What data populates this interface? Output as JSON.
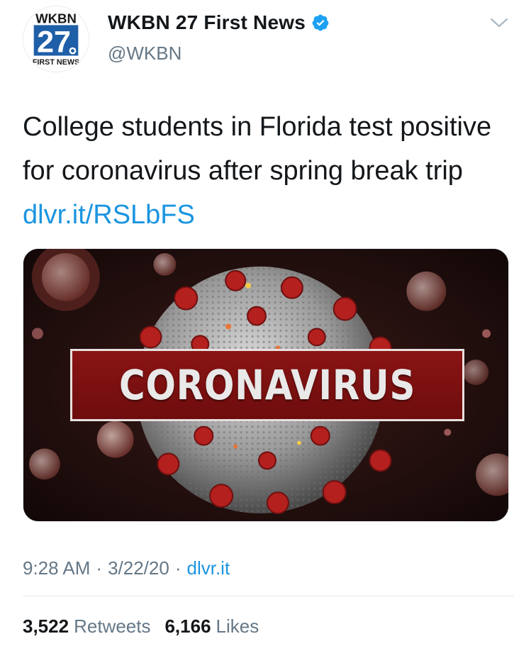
{
  "account": {
    "display_name": "WKBN 27 First News",
    "handle": "@WKBN",
    "avatar_logo": {
      "call_letters": "WKBN",
      "channel": "27",
      "tagline": "FIRST NEWS",
      "brand_color": "#1f5fa8"
    },
    "verified_icon": "verified-badge-icon"
  },
  "menu_icon": "chevron-down-icon",
  "tweet": {
    "text": "College students in Florida test positive for coronavirus after spring break trip",
    "link_text": "dlvr.it/RSLbFS",
    "link_color": "#1b95e0"
  },
  "media": {
    "banner_text": "CORONAVIRUS",
    "banner_color": "#7a1010"
  },
  "meta": {
    "time": "9:28 AM",
    "separator": "·",
    "date": "3/22/20",
    "source": "dlvr.it"
  },
  "stats": {
    "retweets_count": "3,522",
    "retweets_label": "Retweets",
    "likes_count": "6,166",
    "likes_label": "Likes"
  }
}
